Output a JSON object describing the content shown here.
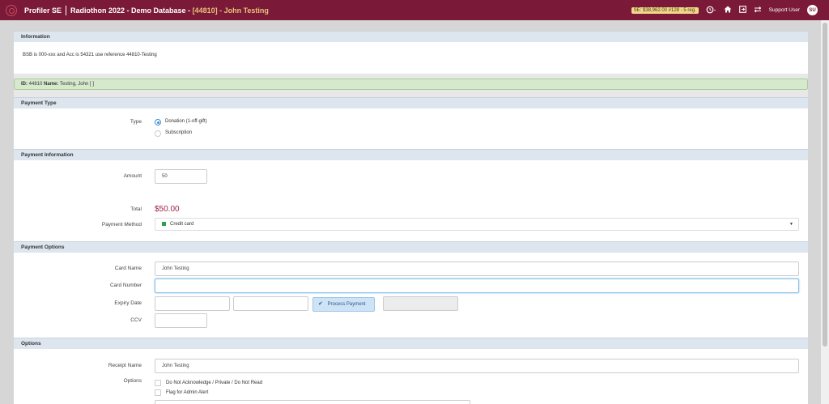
{
  "header": {
    "brand": "Profiler SE",
    "db_title": "Radiothon 2022 - Demo Database - ",
    "record": "[44810] - John Testing",
    "se_badge": "SE: $38,962.00 #128 - 5 reg.",
    "history_icon": "history-icon",
    "home_icon": "home-icon",
    "export_icon": "export-icon",
    "switch_icon": "switch-icon",
    "user_name": "Support User",
    "avatar_initials": "SU"
  },
  "information": {
    "title": "Information",
    "text": "BSB is 000-xxx and Acc is 54321 use reference 44810-Testing"
  },
  "id_bar": {
    "id_label": "ID:",
    "id_value": " 44810 ",
    "name_label": "Name:",
    "name_value": " Testing, John [ ]"
  },
  "payment_type": {
    "title": "Payment Type",
    "type_label": "Type",
    "options": [
      "Donation (1-off-gift)",
      "Subscription"
    ],
    "selected": "Donation (1-off-gift)"
  },
  "payment_info": {
    "title": "Payment Information",
    "amount_label": "Amount",
    "amount_value": "50",
    "total_label": "Total",
    "total_value": "$50.00",
    "method_label": "Payment Method",
    "method_value": "Credit card",
    "method_color": "#27a53f"
  },
  "payment_options": {
    "title": "Payment Options",
    "card_name_label": "Card Name",
    "card_name_value": "John Testing",
    "card_number_label": "Card Number",
    "card_number_value": "",
    "expiry_label": "Expiry Date",
    "process_button": "Process Payment",
    "ccv_label": "CCV"
  },
  "options": {
    "title": "Options",
    "receipt_label": "Receipt Name",
    "receipt_value": "John Testing",
    "options_label": "Options",
    "checkboxes": [
      "Do Not Acknowledge / Private / Do Not Read",
      "Flag for Admin Alert"
    ]
  },
  "colors": {
    "brand_bar": "#7b1a38",
    "section_header": "#dde6ef",
    "id_bar": "#d7e9cd",
    "total_text": "#9c2245"
  }
}
